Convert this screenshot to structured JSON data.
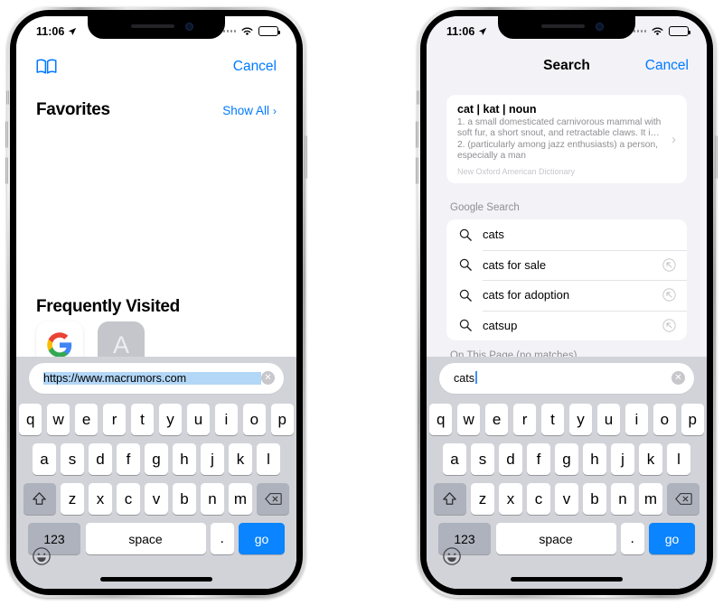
{
  "status_bar": {
    "time": "11:06",
    "location_icon": "location-arrow-icon",
    "signal_icon": "cellular-dots-icon",
    "wifi_icon": "wifi-icon",
    "battery_icon": "battery-icon"
  },
  "left_phone": {
    "name": "safari-favorites-screen",
    "nav": {
      "bookmarks_icon": "bookmarks-book-icon",
      "cancel_label": "Cancel"
    },
    "favorites": {
      "title": "Favorites",
      "show_all_label": "Show All",
      "chevron": "›"
    },
    "frequently_visited": {
      "title": "Frequently Visited",
      "tiles": [
        {
          "name": "google-tile",
          "label": "G",
          "kind": "google-logo"
        },
        {
          "name": "letter-tile",
          "label": "A",
          "kind": "letter"
        }
      ]
    },
    "url_field": {
      "value": "https://www.macrumors.com",
      "selected": true,
      "clear_icon": "clear-circle-icon"
    }
  },
  "right_phone": {
    "name": "safari-search-suggestions-screen",
    "nav": {
      "title": "Search",
      "cancel_label": "Cancel"
    },
    "dictionary_card": {
      "headword": "cat | kat | noun",
      "definitions": "1. a small domesticated carnivorous mammal with soft fur, a short snout, and retractable claws. It i… 2. (particularly among jazz enthusiasts) a person, especially a man",
      "source": "New Oxford American Dictionary",
      "chevron": "›"
    },
    "google_search": {
      "label": "Google Search",
      "suggestions": [
        {
          "text": "cats",
          "has_arrow": false
        },
        {
          "text": "cats for sale",
          "has_arrow": true
        },
        {
          "text": "cats for adoption",
          "has_arrow": true
        },
        {
          "text": "catsup",
          "has_arrow": true
        }
      ]
    },
    "on_this_page": {
      "label": "On This Page (no matches)"
    },
    "url_field": {
      "value": "cats",
      "selected": false,
      "clear_icon": "clear-circle-icon"
    }
  },
  "keyboard": {
    "row1": [
      "q",
      "w",
      "e",
      "r",
      "t",
      "y",
      "u",
      "i",
      "o",
      "p"
    ],
    "row2": [
      "a",
      "s",
      "d",
      "f",
      "g",
      "h",
      "j",
      "k",
      "l"
    ],
    "row3": [
      "z",
      "x",
      "c",
      "v",
      "b",
      "n",
      "m"
    ],
    "shift_icon": "shift-arrow-icon",
    "delete_icon": "delete-backspace-icon",
    "numbers_label": "123",
    "space_label": "space",
    "period_label": ".",
    "go_label": "go",
    "emoji_icon": "emoji-smiley-icon"
  },
  "colors": {
    "accent_blue": "#007aff",
    "go_blue": "#0a84ff",
    "keyboard_bg": "#d1d3d9",
    "results_bg": "#f2f2f7",
    "selection_blue": "#b3d7f7"
  }
}
